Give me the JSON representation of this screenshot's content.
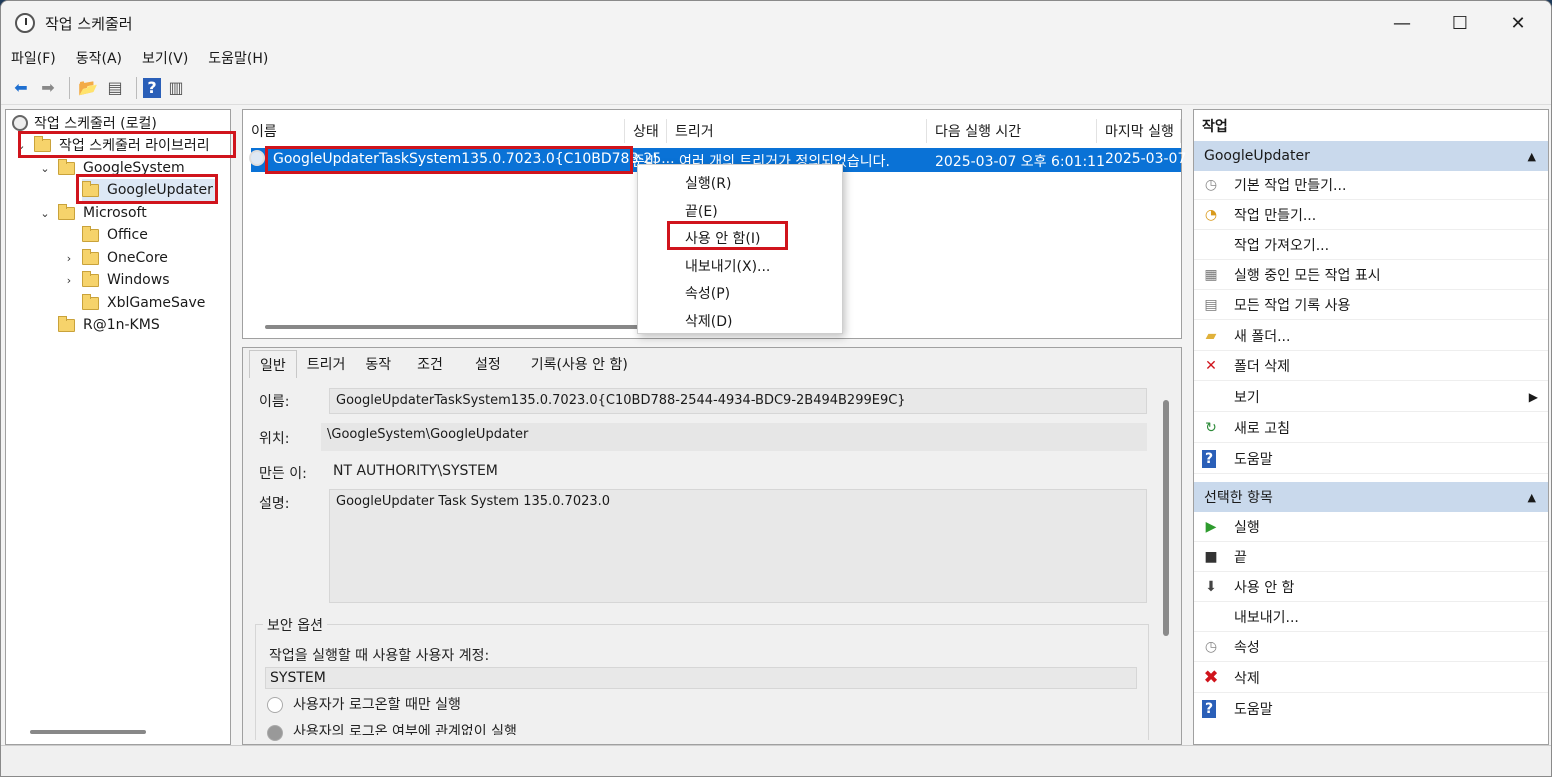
{
  "window": {
    "title": "작업 스케줄러",
    "minimize": "—",
    "maximize": "☐",
    "close": "✕"
  },
  "menu": [
    "파일(F)",
    "동작(A)",
    "보기(V)",
    "도움말(H)"
  ],
  "tree": {
    "root": "작업 스케줄러 (로컬)",
    "library": "작업 스케줄러 라이브러리",
    "items": [
      "GoogleSystem",
      "GoogleUpdater",
      "Microsoft",
      "Office",
      "OneCore",
      "Windows",
      "XblGameSave",
      "R@1n-KMS"
    ]
  },
  "list": {
    "columns": [
      "이름",
      "상태",
      "트리거",
      "다음 실행 시간",
      "마지막 실행"
    ],
    "row": {
      "name": "GoogleUpdaterTaskSystem135.0.7023.0{C10BD788-25...",
      "status": "준비",
      "trigger": "여러 개의 트리거가 정의되었습니다.",
      "next_run": "2025-03-07 오후 6:01:11",
      "last_run": "2025-03-07"
    }
  },
  "context_menu": [
    "실행(R)",
    "끝(E)",
    "사용 안 함(I)",
    "내보내기(X)...",
    "속성(P)",
    "삭제(D)"
  ],
  "detail": {
    "tabs": [
      "일반",
      "트리거",
      "동작",
      "조건",
      "설정",
      "기록(사용 안 함)"
    ],
    "name_label": "이름:",
    "name_value": "GoogleUpdaterTaskSystem135.0.7023.0{C10BD788-2544-4934-BDC9-2B494B299E9C}",
    "location_label": "위치:",
    "location_value": "\\GoogleSystem\\GoogleUpdater",
    "author_label": "만든 이:",
    "author_value": "NT AUTHORITY\\SYSTEM",
    "desc_label": "설명:",
    "desc_value": "GoogleUpdater Task System 135.0.7023.0",
    "security_title": "보안 옵션",
    "account_label": "작업을 실행할 때 사용할 사용자 계정:",
    "account_value": "SYSTEM",
    "radio1": "사용자가 로그온할 때만 실행",
    "radio2": "사용자의 로그온 여부에 관계없이 실행"
  },
  "actions": {
    "header": "작업",
    "section1": "GoogleUpdater",
    "items1": [
      "기본 작업 만들기...",
      "작업 만들기...",
      "작업 가져오기...",
      "실행 중인 모든 작업 표시",
      "모든 작업 기록 사용",
      "새 폴더...",
      "폴더 삭제",
      "보기",
      "새로 고침",
      "도움말"
    ],
    "section2": "선택한 항목",
    "items2": [
      "실행",
      "끝",
      "사용 안 함",
      "내보내기...",
      "속성",
      "삭제",
      "도움말"
    ]
  },
  "colors": {
    "selection": "#0a72d6",
    "highlight_box": "#d0141c",
    "section_bg": "#c9d9ec"
  }
}
